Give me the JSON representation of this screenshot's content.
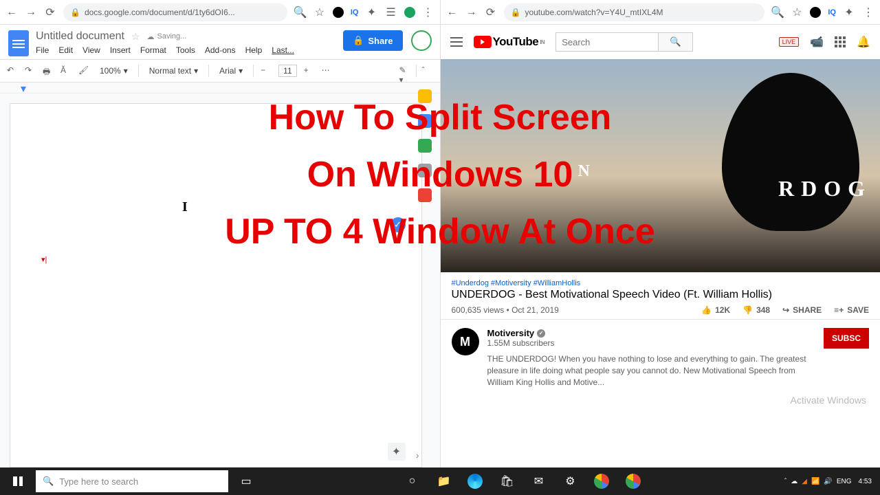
{
  "left": {
    "url": "docs.google.com/document/d/1ty6dOI6...",
    "docTitle": "Untitled document",
    "saving": "Saving...",
    "menus": [
      "File",
      "Edit",
      "View",
      "Insert",
      "Format",
      "Tools",
      "Add-ons",
      "Help"
    ],
    "lastEdit": "Last...",
    "shareLabel": "Share",
    "zoom": "100%",
    "styleSel": "Normal text",
    "fontSel": "Arial",
    "fontSize": "11"
  },
  "right": {
    "url": "youtube.com/watch?v=Y4U_mtIXL4M",
    "logoText": "YouTube",
    "logoSup": "IN",
    "searchPlaceholder": "Search",
    "liveBadge": "LIVE",
    "videoOverlayMain": "RDOG",
    "videoOverlaySub": "N",
    "tags": "#Underdog #Motiversity #WilliamHollis",
    "title": "UNDERDOG - Best Motivational Speech Video (Ft. William Hollis)",
    "views": "600,635 views",
    "date": "Oct 21, 2019",
    "likes": "12K",
    "dislikes": "348",
    "shareLabel": "SHARE",
    "saveLabel": "SAVE",
    "channelName": "Motiversity",
    "channelInitial": "M",
    "subs": "1.55M subscribers",
    "subscribeLabel": "SUBSC",
    "description": "THE UNDERDOG! When you have nothing to lose and everything to gain. The greatest pleasure in life doing what people say you cannot do. New Motivational Speech from William King Hollis and Motive...",
    "activate": "Activate Windows"
  },
  "overlay": {
    "line1": "How To Split Screen",
    "line2": "On Windows 10",
    "line3": "UP TO 4 Window At Once"
  },
  "taskbar": {
    "searchPlaceholder": "Type here to search",
    "time": "4:53",
    "lang": "ENG"
  }
}
